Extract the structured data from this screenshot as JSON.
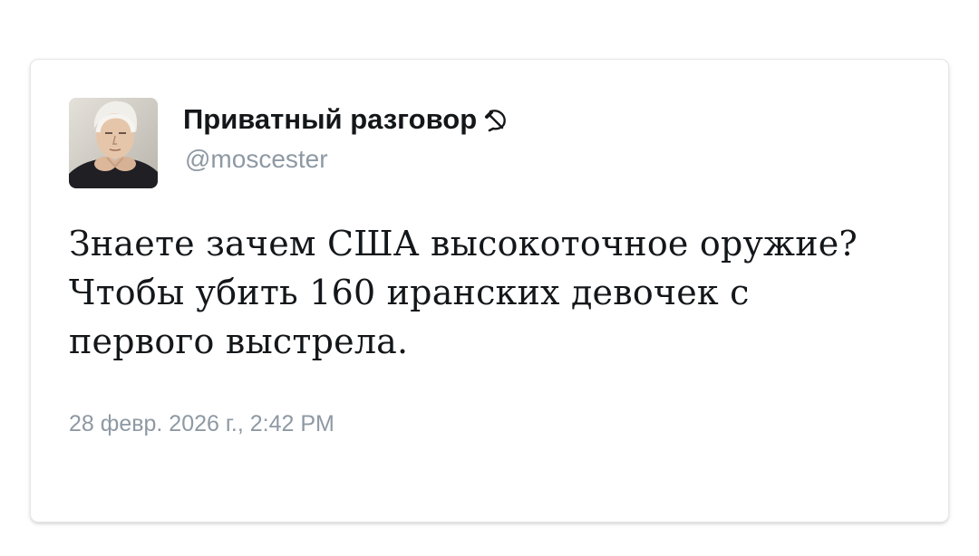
{
  "tweet": {
    "author": {
      "display_name": "Приватный разговор",
      "badge_icon": "hammer-and-sickle-icon",
      "handle": "@moscester",
      "avatar": "avatar-photo"
    },
    "text": "Знаете зачем США высокоточное оружие? Чтобы убить 160 иранских девочек с первого выстрела.",
    "timestamp": "28 февр. 2026 г., 2:42 PM"
  },
  "colors": {
    "name": "#14171a",
    "secondary_text": "#8e99a4",
    "card_background": "#ffffff"
  }
}
